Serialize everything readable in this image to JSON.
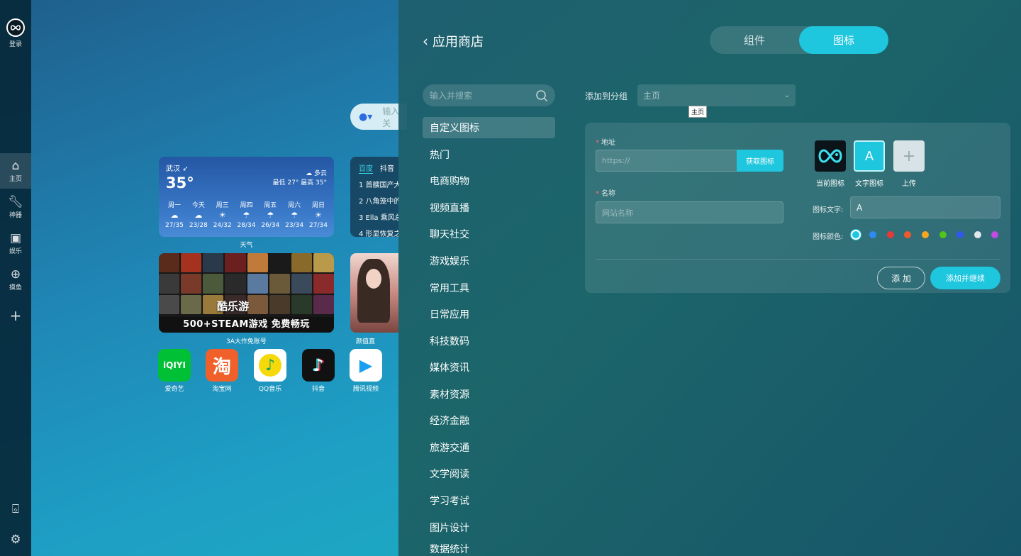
{
  "rail": {
    "login": "登录",
    "items": [
      {
        "label": "主页",
        "icon": "home-icon"
      },
      {
        "label": "神器",
        "icon": "wrench-icon"
      },
      {
        "label": "娱乐",
        "icon": "tv-icon"
      },
      {
        "label": "摸鱼",
        "icon": "gamepad-icon"
      }
    ]
  },
  "desktop": {
    "search_placeholder": "输入关",
    "weather": {
      "city": "武汉",
      "temp": "35°",
      "condition": "多云",
      "range": "最低 27° 最高 35°",
      "days": [
        {
          "name": "周一",
          "range": "27/35"
        },
        {
          "name": "今天",
          "range": "23/28"
        },
        {
          "name": "周三",
          "range": "24/32"
        },
        {
          "name": "周四",
          "range": "28/34"
        },
        {
          "name": "周五",
          "range": "26/34"
        },
        {
          "name": "周六",
          "range": "23/34"
        },
        {
          "name": "周日",
          "range": "27/34"
        }
      ],
      "caption": "天气"
    },
    "hot": {
      "tabs": [
        "百度",
        "抖音"
      ],
      "rows": [
        "1 首艘国产大",
        "2 八角笼中的",
        "3 Ella 乘风总",
        "4 形显恢复之"
      ]
    },
    "games": {
      "logo": "酷乐游",
      "banner": "500+STEAM游戏 免费畅玩",
      "caption": "3A大作免账号"
    },
    "live_caption": "颜值直",
    "apps": [
      {
        "label": "爱奇艺",
        "tile": "iQIYI"
      },
      {
        "label": "淘宝网",
        "tile": "淘"
      },
      {
        "label": "QQ音乐",
        "tile": "♪"
      },
      {
        "label": "抖音",
        "tile": "♪"
      },
      {
        "label": "腾讯视频",
        "tile": "▶"
      }
    ]
  },
  "panel": {
    "back_label": "应用商店",
    "tabs": [
      "组件",
      "图标"
    ],
    "search_placeholder": "输入并搜索",
    "categories": [
      "自定义图标",
      "热门",
      "电商购物",
      "视频直播",
      "聊天社交",
      "游戏娱乐",
      "常用工具",
      "日常应用",
      "科技数码",
      "媒体资讯",
      "素材资源",
      "经济金融",
      "旅游交通",
      "文学阅读",
      "学习考试",
      "图片设计",
      "数据统计"
    ],
    "group_label": "添加到分组",
    "group_value": "主页",
    "tooltip": "主页",
    "address_label": "地址",
    "address_placeholder": "https://",
    "fetch_button": "获取图标",
    "name_label": "名称",
    "name_placeholder": "网站名称",
    "icon_options": [
      {
        "caption": "当前图标"
      },
      {
        "caption": "文字图标",
        "text": "A"
      },
      {
        "caption": "上传",
        "text": "+"
      }
    ],
    "icon_text_label": "图标文字:",
    "icon_text_value": "A",
    "icon_color_label": "图标颜色:",
    "colors": [
      "#1ec6de",
      "#2d8cf0",
      "#e83838",
      "#f05a2a",
      "#f5a623",
      "#52c41a",
      "#3057f0",
      "#dfe8ea",
      "#c04ce0"
    ],
    "add_button": "添 加",
    "add_continue_button": "添加并继续"
  }
}
